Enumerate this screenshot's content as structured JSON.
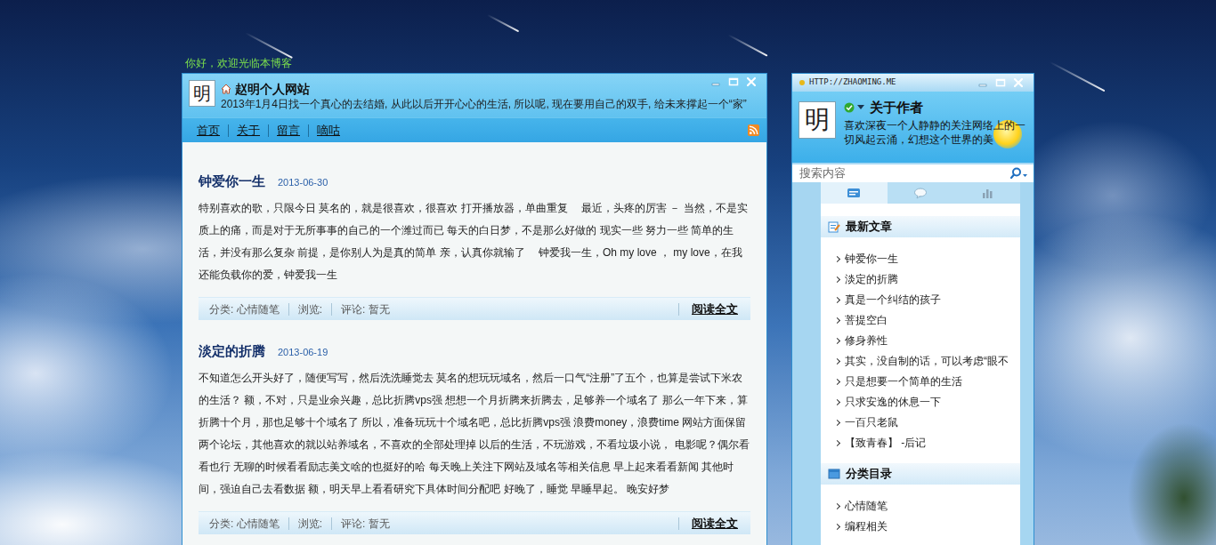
{
  "greeting": "你好，欢迎光临本博客",
  "site": {
    "logo": "明",
    "title": "赵明个人网站",
    "subtitle": "2013年1月4日找一个真心的去结婚, 从此以后开开心心的生活, 所以呢, 现在要用自己的双手, 给未来撑起一个“家”",
    "nav": [
      "首页",
      "关于",
      "留言",
      "嘀咕"
    ]
  },
  "posts": [
    {
      "title": "钟爱你一生",
      "date": "2013-06-30",
      "excerpt": "特别喜欢的歌，只限今日 莫名的，就是很喜欢，很喜欢 打开播放器，单曲重复　 最近，头疼的厉害 － 当然，不是实质上的痛，而是对于无所事事的自己的一个潍过而已 每天的白日梦，不是那么好做的 现实一些 努力一些 简单的生活，并没有那么复杂 前提，是你别人为是真的简单 亲，认真你就输了　 钟爱我一生，Oh my love ， my love，在我还能负载你的爱，钟爱我一生",
      "category": "分类: 心情随笔",
      "views": "浏览:",
      "comments": "评论: 暂无",
      "read_more": "阅读全文"
    },
    {
      "title": "淡定的折腾",
      "date": "2013-06-19",
      "excerpt": "不知道怎么开头好了，随便写写，然后洗洗睡觉去 莫名的想玩玩域名，然后一口气“注册”了五个，也算是尝试下米农的生活？ 额，不对，只是业余兴趣，总比折腾vps强 想想一个月折腾来折腾去，足够养一个域名了 那么一年下来，算折腾十个月，那也足够十个域名了 所以，准备玩玩十个域名吧，总比折腾vps强 浪费money，浪费time 网站方面保留两个论坛，其他喜欢的就以站养域名，不喜欢的全部处理掉 以后的生活，不玩游戏，不看垃圾小说， 电影呢？偶尔看看也行 无聊的时候看看励志美文啥的也挺好的哈 每天晚上关注下网站及域名等相关信息 早上起来看看新闻 其他时间，强迫自己去看数据 额，明天早上看看研究下具体时间分配吧 好晚了，睡觉 早睡早起。 晚安好梦",
      "category": "分类: 心情随笔",
      "views": "浏览:",
      "comments": "评论: 暂无",
      "read_more": "阅读全文"
    }
  ],
  "sidebar": {
    "url": "HTTP://ZHAOMING.ME",
    "logo": "明",
    "title": "关于作者",
    "description": "喜欢深夜一个人静静的关注网络上的一切风起云涌，幻想这个世界的美",
    "search": {
      "placeholder": "搜索内容"
    },
    "tabs": [
      {
        "kind": "articles",
        "selected": true
      },
      {
        "kind": "comments",
        "selected": false
      },
      {
        "kind": "stats",
        "selected": false
      }
    ],
    "recent": {
      "title": "最新文章",
      "items": [
        "钟爱你一生",
        "淡定的折腾",
        "真是一个纠结的孩子",
        "菩提空白",
        "修身养性",
        "其实，没自制的话，可以考虑“眼不",
        "只是想要一个简单的生活",
        "只求安逸的休息一下",
        "一百只老鼠",
        "【致青春】 -后记"
      ]
    },
    "categories": {
      "title": "分类目录",
      "items": [
        "心情随笔",
        "编程相关"
      ]
    }
  }
}
